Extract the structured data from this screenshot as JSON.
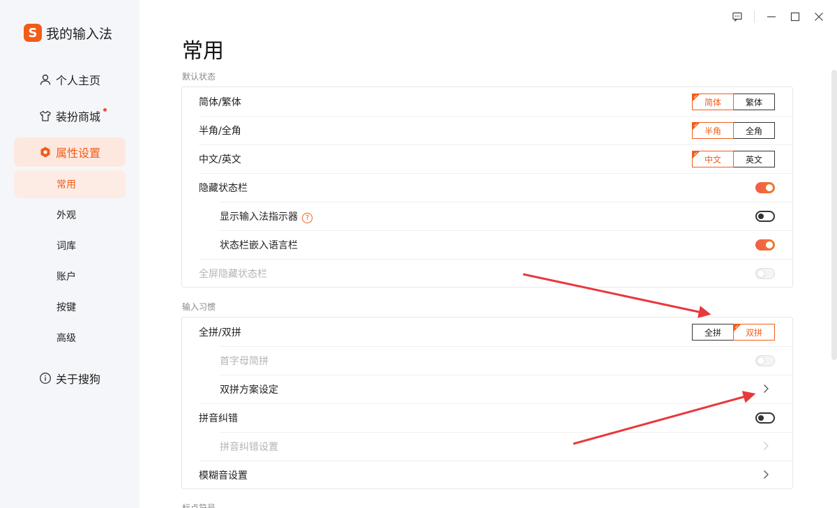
{
  "sidebar": {
    "brand": {
      "logo_letter": "S",
      "title": "我的输入法"
    },
    "items": [
      {
        "label": "个人主页",
        "icon": "user-icon"
      },
      {
        "label": "装扮商城",
        "icon": "tshirt-icon",
        "badge_dot": true
      },
      {
        "label": "属性设置",
        "icon": "hexagon-settings-icon",
        "active": true
      },
      {
        "label": "关于搜狗",
        "icon": "info-icon"
      }
    ],
    "subitems": [
      {
        "label": "常用",
        "active": true
      },
      {
        "label": "外观"
      },
      {
        "label": "词库"
      },
      {
        "label": "账户"
      },
      {
        "label": "按键"
      },
      {
        "label": "高级"
      }
    ]
  },
  "window_controls": [
    "feedback-icon",
    "minimize-icon",
    "maximize-icon",
    "close-icon"
  ],
  "page": {
    "title": "常用"
  },
  "sections": {
    "default_state": {
      "label": "默认状态",
      "rows": {
        "simp_trad": {
          "label": "简体/繁体",
          "options": [
            "简体",
            "繁体"
          ],
          "selected": "简体"
        },
        "half_full": {
          "label": "半角/全角",
          "options": [
            "半角",
            "全角"
          ],
          "selected": "半角"
        },
        "cn_en": {
          "label": "中文/英文",
          "options": [
            "中文",
            "英文"
          ],
          "selected": "中文"
        },
        "hide_status": {
          "label": "隐藏状态栏",
          "toggle": "on"
        },
        "show_indicator": {
          "label": "显示输入法指示器",
          "toggle": "off",
          "help": "?"
        },
        "embed_lang": {
          "label": "状态栏嵌入语言栏",
          "toggle": "on"
        },
        "fullscreen_hide": {
          "label": "全屏隐藏状态栏",
          "toggle": "disabled"
        }
      }
    },
    "input_habits": {
      "label": "输入习惯",
      "rows": {
        "quanpin_shuangpin": {
          "label": "全拼/双拼",
          "options": [
            "全拼",
            "双拼"
          ],
          "selected": "双拼"
        },
        "initials": {
          "label": "首字母简拼",
          "toggle": "disabled"
        },
        "shuangpin_scheme": {
          "label": "双拼方案设定"
        },
        "pinyin_correct": {
          "label": "拼音纠错",
          "toggle": "off"
        },
        "pinyin_correct_settings": {
          "label": "拼音纠错设置"
        },
        "fuzzy": {
          "label": "模糊音设置"
        }
      }
    },
    "punctuation": {
      "label": "标点符号"
    }
  },
  "colors": {
    "accent": "#f25c19",
    "annotation_arrow": "#e8383b"
  }
}
